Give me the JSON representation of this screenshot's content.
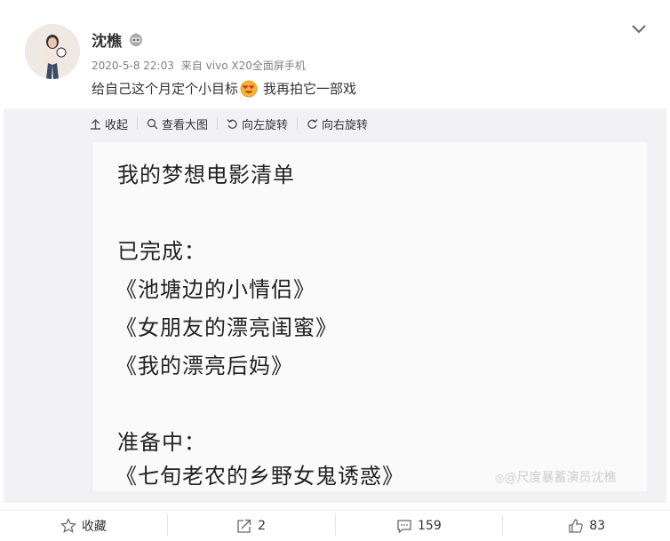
{
  "post": {
    "username": "沈樵",
    "timestamp": "2020-5-8 22:03",
    "source_prefix": "来自",
    "source_device": "vivo X20全面屏手机",
    "text_before_emoji": "给自己这个月定个小目标",
    "text_after_emoji": "我再拍它一部戏"
  },
  "toolbar": {
    "collapse": "收起",
    "view_large": "查看大图",
    "rotate_left": "向左旋转",
    "rotate_right": "向右旋转"
  },
  "photo": {
    "title": "我的梦想电影清单",
    "done_header": "已完成：",
    "done_items": [
      "《池塘边的小情侣》",
      "《女朋友的漂亮闺蜜》",
      "《我的漂亮后妈》"
    ],
    "todo_header": "准备中：",
    "todo_items": [
      "《七旬老农的乡野女鬼诱惑》"
    ],
    "watermark": "@尺度暴蓄演员沈樵"
  },
  "footer": {
    "favorite": "收藏",
    "repost_count": "2",
    "comment_count": "159",
    "like_count": "83"
  },
  "colors": {
    "accent_orange": "#fa7d3c",
    "text_gray": "#808080",
    "media_bg": "#f2f2f5"
  }
}
